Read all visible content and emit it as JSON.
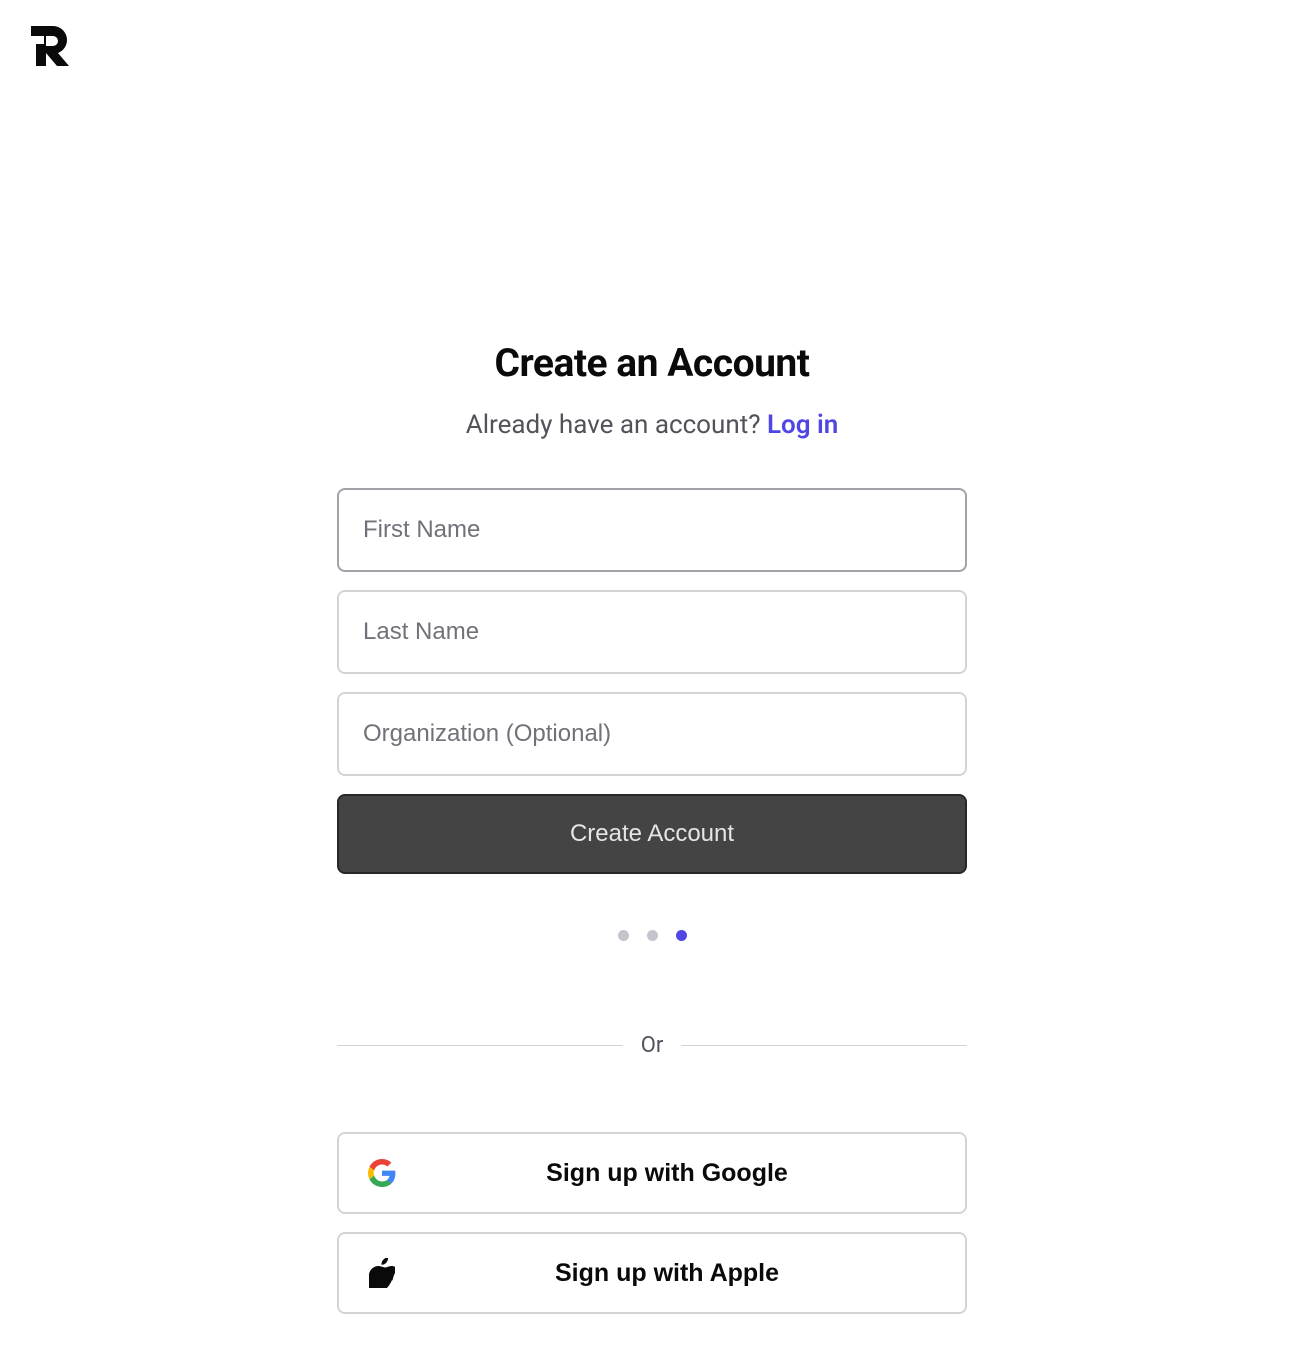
{
  "page": {
    "title": "Create an Account",
    "subtitle_prefix": "Already have an account? ",
    "login_link_text": "Log in"
  },
  "form": {
    "first_name": {
      "placeholder": "First Name",
      "value": ""
    },
    "last_name": {
      "placeholder": "Last Name",
      "value": ""
    },
    "organization": {
      "placeholder": "Organization (Optional)",
      "value": ""
    },
    "submit_label": "Create Account"
  },
  "progress": {
    "total": 3,
    "active_index": 2
  },
  "divider": {
    "label": "Or"
  },
  "social": {
    "google_label": "Sign up with Google",
    "apple_label": "Sign up with Apple"
  },
  "colors": {
    "accent": "#4f46e5",
    "border": "#d4d4d8",
    "button_bg": "#444444"
  }
}
